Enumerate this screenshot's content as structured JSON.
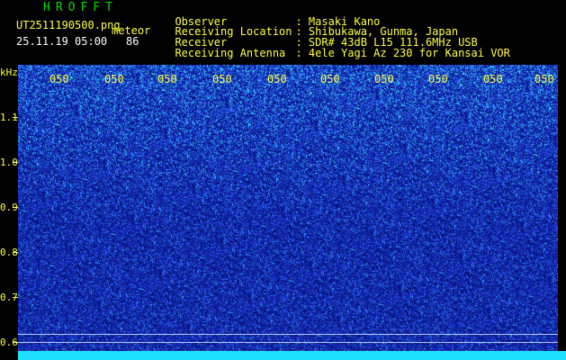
{
  "header": {
    "app_title": "HROFFT",
    "filename": "UT2511190500.png",
    "mode_label": "meteor",
    "datetime": "25.11.19 05:00",
    "count": "86"
  },
  "info": [
    {
      "key": "Observer",
      "value": ": Masaki Kano"
    },
    {
      "key": "Receiving Location",
      "value": ": Shibukawa, Gunma, Japan"
    },
    {
      "key": "Receiver",
      "value": ": SDR# 43dB L15 111.6MHz USB"
    },
    {
      "key": "Receiving Antenna",
      "value": ": 4ele Yagi Az 230 for Kansai VOR"
    }
  ],
  "y_axis": {
    "unit": "kHz",
    "ticks": [
      "1.1",
      "1.0",
      "0.9",
      "0.8",
      "0.7",
      "0.6"
    ]
  },
  "x_axis": {
    "ticks": [
      "050",
      "050",
      "050",
      "050",
      "050",
      "050",
      "050",
      "050",
      "050",
      "050",
      "0510"
    ]
  },
  "colors": {
    "background": "#000000",
    "label": "#ffff40",
    "title": "#00e000",
    "spectrum_base": "#0a1a9a",
    "spectrum_noise": "#4060ff",
    "spectrum_bright": "#40e0ff",
    "bottom_band": "#20e0ff"
  }
}
